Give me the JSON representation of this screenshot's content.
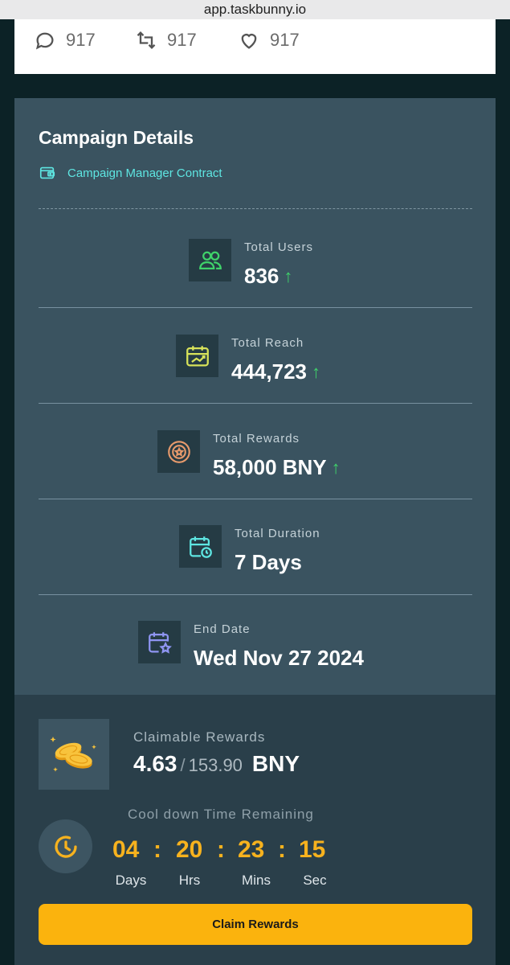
{
  "browser": {
    "url": "app.taskbunny.io"
  },
  "tweet": {
    "replies": "917",
    "retweets": "917",
    "likes": "917"
  },
  "campaign": {
    "title": "Campaign Details",
    "contract_link": "Campaign Manager Contract",
    "stats": [
      {
        "label": "Total Users",
        "value": "836",
        "trend": "up",
        "icon": "users-icon",
        "color": "#3fd26a"
      },
      {
        "label": "Total Reach",
        "value": "444,723",
        "trend": "up",
        "icon": "calendar-chart-icon",
        "color": "#d8e35a"
      },
      {
        "label": "Total Rewards",
        "value": "58,000 BNY",
        "trend": "up",
        "icon": "reward-medal-icon",
        "color": "#e79a6c"
      },
      {
        "label": "Total Duration",
        "value": "7 Days",
        "trend": "",
        "icon": "calendar-clock-icon",
        "color": "#5ee6e2"
      },
      {
        "label": "End Date",
        "value": "Wed Nov 27 2024",
        "trend": "",
        "icon": "calendar-star-icon",
        "color": "#8f95f2"
      }
    ],
    "trend_arrow": "↑"
  },
  "rewards": {
    "claimable_label": "Claimable Rewards",
    "claimable": "4.63",
    "separator": "/",
    "total": "153.90",
    "unit": "BNY",
    "cooldown_label": "Cool down Time Remaining",
    "countdown": {
      "days": "04",
      "hours": "20",
      "mins": "23",
      "secs": "15",
      "colon": ":",
      "days_label": "Days",
      "hours_label": "Hrs",
      "mins_label": "Mins",
      "secs_label": "Sec"
    },
    "claim_button": "Claim Rewards",
    "accent_color": "#fbb30d"
  }
}
